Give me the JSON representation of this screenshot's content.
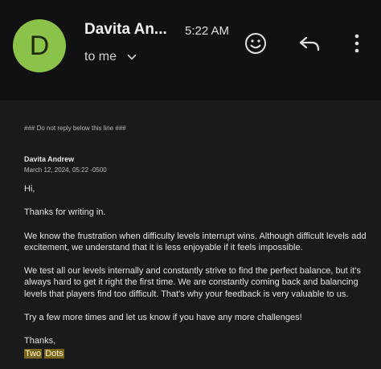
{
  "header": {
    "avatar_letter": "D",
    "sender_name": "Davita An...",
    "time": "5:22 AM",
    "to_label": "to me"
  },
  "email": {
    "note": "### Do not reply below this line ###",
    "from_name": "Davita Andrew",
    "from_date": "March 12, 2024, 05:22 -0500",
    "greeting": "Hi,",
    "p1": "Thanks for writing in.",
    "p2": "We know the frustration when difficulty levels interrupt wins. Although difficult levels add excitement, we understand that it is less enjoyable if it feels impossible.",
    "p3": "We test all our levels internally and constantly strive to find the perfect balance, but it's always hard to get it right the first time. We are constantly coming back and balancing levels that players find too difficult. That's why your feedback is very valuable to us.",
    "p4": "Try a few more times and let us know if you have any more challenges!",
    "signoff": "Thanks,",
    "signature_word1": "Two",
    "signature_word2": "Dots"
  },
  "colors": {
    "background": "#111113",
    "avatar": "#8bc34a",
    "highlight": "#7a6418"
  },
  "icons": [
    "smiley-icon",
    "reply-icon",
    "more-vert-icon",
    "chevron-down-icon"
  ]
}
